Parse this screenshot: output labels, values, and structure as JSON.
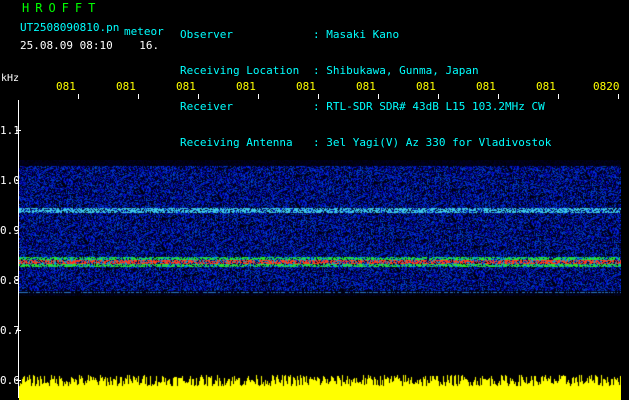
{
  "header": {
    "title": "HROFFT",
    "filename": "UT2508090810.pn",
    "meteor_label": "meteor",
    "timestamp": "25.08.09 08:10",
    "count": "16.",
    "labels": [
      "Observer",
      "Receiving Location",
      "Receiver",
      "Receiving Antenna"
    ],
    "values": [
      ": Masaki Kano",
      ": Shibukawa, Gunma, Japan",
      ": RTL-SDR SDR# 43dB L15 103.2MHz CW",
      ": 3el Yagi(V) Az 330 for Vladivostok"
    ]
  },
  "y_axis": {
    "unit": "kHz",
    "ticks": [
      "1.1",
      "1.0",
      "0.9",
      "0.8",
      "0.7",
      "0.6"
    ]
  },
  "x_axis": {
    "ticks": [
      "081",
      "081",
      "081",
      "081",
      "081",
      "081",
      "081",
      "081",
      "081",
      "0820"
    ]
  },
  "colors": {
    "background": "#000000",
    "spectrum_blue": "#0000c8",
    "signal_red": "#ff2020",
    "signal_green": "#30ff30",
    "bars": "#ffff00",
    "axis_text": "#ffffff",
    "time_labels": "#ffff00",
    "title": "#00ff00",
    "header_text": "#00ffff"
  }
}
